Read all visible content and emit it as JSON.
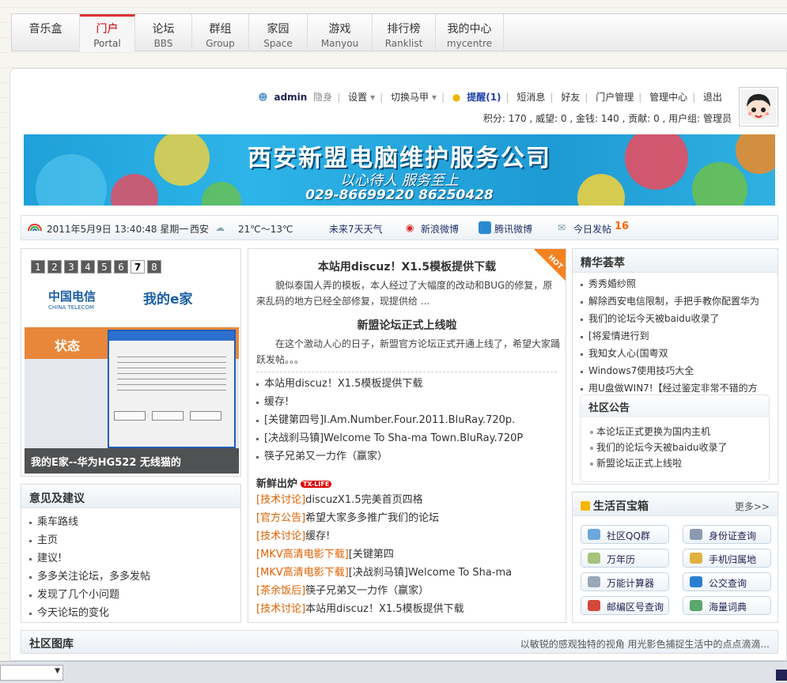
{
  "nav": [
    {
      "cn": "音乐盒",
      "en": ""
    },
    {
      "cn": "门户",
      "en": "Portal",
      "active": true
    },
    {
      "cn": "论坛",
      "en": "BBS"
    },
    {
      "cn": "群组",
      "en": "Group"
    },
    {
      "cn": "家园",
      "en": "Space"
    },
    {
      "cn": "游戏",
      "en": "Manyou"
    },
    {
      "cn": "排行榜",
      "en": "Ranklist"
    },
    {
      "cn": "我的中心",
      "en": "mycentre"
    }
  ],
  "user": {
    "name": "admin",
    "invisible": "隐身",
    "settings": "设置",
    "switch": "切换马甲",
    "remind": "提醒(1)",
    "sms": "短消息",
    "friends": "好友",
    "portal_manage": "门户管理",
    "admin_center": "管理中心",
    "logout": "退出",
    "stats": "积分: 170 , 威望: 0 , 金钱: 140 , 贡献: 0 , 用户组: 管理员"
  },
  "banner": {
    "line1": "西安新盟电脑维护服务公司",
    "line2": "以心待人   服务至上",
    "line3": "029-86699220    86250428"
  },
  "infobar": {
    "datetime": "2011年5月9日 13:40:48 星期一",
    "city": "西安",
    "temp": "21℃～13℃",
    "forecast": "未来7天天气",
    "sina": "新浪微博",
    "tencent": "腾讯微博",
    "today_label": "今日发帖",
    "today_count": "16"
  },
  "slider": {
    "pages": [
      "1",
      "2",
      "3",
      "4",
      "5",
      "6",
      "7",
      "8"
    ],
    "active": "7",
    "caption": "我的E家--华为HG522 无线猫的",
    "brand1": "中国电信",
    "brand1_en": "CHINA TELECOM",
    "brand2": "我的e家",
    "status": "状态"
  },
  "center": {
    "hot": "HOT",
    "title1": "本站用discuz！X1.5模板提供下载",
    "para1": "貌似泰国人弄的模板，本人经过了大幅度的改动和BUG的修复，原来乱码的地方已经全部修复，现提供给 ...",
    "title2": "新盟论坛正式上线啦",
    "para2": "在这个激动人心的日子，新盟官方论坛正式开通上线了，希望大家踊跃发帖。。。",
    "list": [
      "本站用discuz！X1.5模板提供下载",
      "缓存!",
      "[关键第四号]I.Am.Number.Four.2011.BluRay.720p.",
      "[决战刹马镇]Welcome To Sha-ma Town.BluRay.720P",
      "筷子兄弟又一力作（赢家）"
    ],
    "fresh_title": "新鲜出炉",
    "fresh_badge": "TX-LIFE",
    "fresh": [
      {
        "tag": "[技术讨论]",
        "text": "discuzX1.5完美首页四格"
      },
      {
        "tag": "[官方公告]",
        "text": "希望大家多多推广我们的论坛"
      },
      {
        "tag": "[技术讨论]",
        "text": "缓存!"
      },
      {
        "tag": "[MKV高清电影下载]",
        "text": "[关键第四"
      },
      {
        "tag": "[MKV高清电影下载]",
        "text": "[决战刹马镇]Welcome To Sha-ma"
      },
      {
        "tag": "[茶余饭后]",
        "text": "筷子兄弟又一力作（赢家）"
      },
      {
        "tag": "[技术讨论]",
        "text": "本站用discuz！X1.5模板提供下载"
      }
    ]
  },
  "suggest": {
    "title": "意见及建议",
    "items": [
      "乘车路线",
      "主页",
      "建议!",
      "多多关注论坛，多多发帖",
      "发现了几个小问题",
      "今天论坛的变化"
    ]
  },
  "digest": {
    "title": "精华荟萃",
    "items": [
      "秀秀婚纱照",
      "解除西安电信限制，手把手教你配置华为",
      "我们的论坛今天被baidu收录了",
      "[将爱情进行到",
      "我知女人心(国粤双",
      "Windows7使用技巧大全",
      "用U盘做WIN7!【经过鉴定非常不错的方"
    ]
  },
  "notice": {
    "title": "社区公告",
    "items": [
      "本论坛正式更换为国内主机",
      "我们的论坛今天被baidu收录了",
      "新盟论坛正式上线啦"
    ]
  },
  "life": {
    "title": "生活百宝箱",
    "more": "更多>>",
    "items": [
      "社区QQ群",
      "身份证查询",
      "万年历",
      "手机归属地",
      "万能计算器",
      "公交查询",
      "邮编区号查询",
      "海量词典"
    ]
  },
  "gallery": {
    "title": "社区图库",
    "slogan": "以敏锐的感观独特的视角 用光影色捕捉生活中的点点滴滴..."
  },
  "colors": {
    "accent": "#cc0000",
    "tag": "#e06000",
    "link": "#223366",
    "banner": "#1fa0d8"
  }
}
